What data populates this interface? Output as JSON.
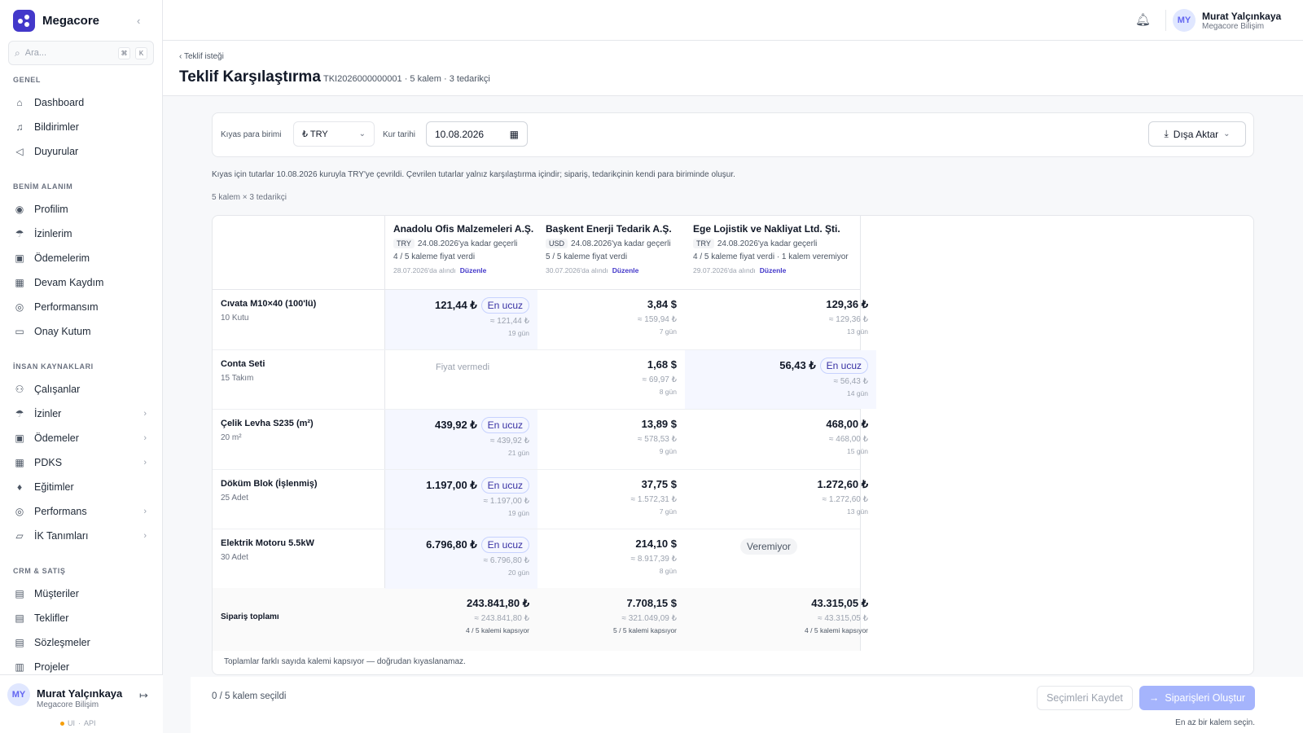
{
  "brand": {
    "name": "Megacore"
  },
  "search": {
    "placeholder": "Ara...",
    "key1": "⌘",
    "key2": "K"
  },
  "sidebar": {
    "sections": [
      {
        "title": "GENEL",
        "items": [
          {
            "label": "Dashboard",
            "icon": "home-icon"
          },
          {
            "label": "Bildirimler",
            "icon": "bell-icon"
          },
          {
            "label": "Duyurular",
            "icon": "megaphone-icon"
          }
        ]
      },
      {
        "title": "BENİM ALANIM",
        "items": [
          {
            "label": "Profilim",
            "icon": "user-circle-icon"
          },
          {
            "label": "İzinlerim",
            "icon": "umbrella-icon"
          },
          {
            "label": "Ödemelerim",
            "icon": "wallet-icon"
          },
          {
            "label": "Devam Kaydım",
            "icon": "calendar-check-icon"
          },
          {
            "label": "Performansım",
            "icon": "target-icon"
          },
          {
            "label": "Onay Kutum",
            "icon": "inbox-icon"
          }
        ]
      },
      {
        "title": "İNSAN KAYNAKLARI",
        "items": [
          {
            "label": "Çalışanlar",
            "icon": "users-icon"
          },
          {
            "label": "İzinler",
            "icon": "umbrella-icon",
            "expandable": true
          },
          {
            "label": "Ödemeler",
            "icon": "wallet-icon",
            "expandable": true
          },
          {
            "label": "PDKS",
            "icon": "calendar-check-icon",
            "expandable": true
          },
          {
            "label": "Eğitimler",
            "icon": "graduation-cap-icon"
          },
          {
            "label": "Performans",
            "icon": "target-icon",
            "expandable": true
          },
          {
            "label": "İK Tanımları",
            "icon": "folder-icon",
            "expandable": true
          }
        ]
      },
      {
        "title": "CRM & SATIŞ",
        "items": [
          {
            "label": "Müşteriler",
            "icon": "building-icon"
          },
          {
            "label": "Teklifler",
            "icon": "document-icon"
          },
          {
            "label": "Sözleşmeler",
            "icon": "contract-icon"
          },
          {
            "label": "Projeler",
            "icon": "briefcase-icon"
          }
        ]
      }
    ],
    "user": {
      "initials": "MY",
      "name": "Murat Yalçınkaya",
      "org": "Megacore Bilişim",
      "status_ui": "UI",
      "status_sep": "·",
      "status_api": "API"
    }
  },
  "header": {
    "user": {
      "initials": "MY",
      "name": "Murat Yalçınkaya",
      "org": "Megacore Bilişim"
    }
  },
  "page": {
    "breadcrumb": "Teklif isteği",
    "title": "Teklif Karşılaştırma",
    "subtitle": "TKI2026000000001 · 5 kalem · 3 tedarikçi"
  },
  "filters": {
    "currency_label": "Kıyas para birimi",
    "currency_value": "₺ TRY",
    "date_label": "Kur tarihi",
    "date_value": "10.08.2026",
    "export_label": "Dışa Aktar"
  },
  "notes": {
    "conversion": "Kıyas için tutarlar 10.08.2026 kuruyla TRY'ye çevrildi. Çevrilen tutarlar yalnız karşılaştırma içindir; sipariş, tedarikçinin kendi para biriminde oluşur.",
    "dimensions": "5 kalem × 3 tedarikçi",
    "footer": "Toplamlar farklı sayıda kalemi kapsıyor — doğrudan kıyaslanamaz."
  },
  "suppliers": [
    {
      "name": "Anadolu Ofis Malzemeleri A.Ş.",
      "currency": "TRY",
      "valid": "24.08.2026'ya kadar geçerli",
      "coverage": "4 / 5 kaleme fiyat verdi",
      "received": "28.07.2026'da alındı",
      "edit": "Düzenle"
    },
    {
      "name": "Başkent Enerji Tedarik A.Ş.",
      "currency": "USD",
      "valid": "24.08.2026'ya kadar geçerli",
      "coverage": "5 / 5 kaleme fiyat verdi",
      "received": "30.07.2026'da alındı",
      "edit": "Düzenle"
    },
    {
      "name": "Ege Lojistik ve Nakliyat Ltd. Şti.",
      "currency": "TRY",
      "valid": "24.08.2026'ya kadar geçerli",
      "coverage": "4 / 5 kaleme fiyat verdi · 1 kalem veremiyor",
      "received": "29.07.2026'da alındı",
      "edit": "Düzenle"
    }
  ],
  "cheapest_label": "En ucuz",
  "items": [
    {
      "name": "Cıvata M10×40 (100'lü)",
      "qty": "10 Kutu",
      "offers": [
        {
          "price": "121,44 ₺",
          "conv": "≈ 121,44 ₺",
          "days": "19 gün",
          "cheapest": true
        },
        {
          "price": "3,84 $",
          "conv": "≈ 159,94 ₺",
          "days": "7 gün"
        },
        {
          "price": "129,36 ₺",
          "conv": "≈ 129,36 ₺",
          "days": "13 gün"
        }
      ]
    },
    {
      "name": "Conta Seti",
      "qty": "15 Takım",
      "offers": [
        {
          "no_price": "Fiyat vermedi"
        },
        {
          "price": "1,68 $",
          "conv": "≈ 69,97 ₺",
          "days": "8 gün"
        },
        {
          "price": "56,43 ₺",
          "conv": "≈ 56,43 ₺",
          "days": "14 gün",
          "cheapest": true
        }
      ]
    },
    {
      "name": "Çelik Levha S235 (m²)",
      "qty": "20 m²",
      "offers": [
        {
          "price": "439,92 ₺",
          "conv": "≈ 439,92 ₺",
          "days": "21 gün",
          "cheapest": true
        },
        {
          "price": "13,89 $",
          "conv": "≈ 578,53 ₺",
          "days": "9 gün"
        },
        {
          "price": "468,00 ₺",
          "conv": "≈ 468,00 ₺",
          "days": "15 gün"
        }
      ]
    },
    {
      "name": "Döküm Blok (İşlenmiş)",
      "qty": "25 Adet",
      "offers": [
        {
          "price": "1.197,00 ₺",
          "conv": "≈ 1.197,00 ₺",
          "days": "19 gün",
          "cheapest": true
        },
        {
          "price": "37,75 $",
          "conv": "≈ 1.572,31 ₺",
          "days": "7 gün"
        },
        {
          "price": "1.272,60 ₺",
          "conv": "≈ 1.272,60 ₺",
          "days": "13 gün"
        }
      ]
    },
    {
      "name": "Elektrik Motoru 5.5kW",
      "qty": "30 Adet",
      "offers": [
        {
          "price": "6.796,80 ₺",
          "conv": "≈ 6.796,80 ₺",
          "days": "20 gün",
          "cheapest": true
        },
        {
          "price": "214,10 $",
          "conv": "≈ 8.917,39 ₺",
          "days": "8 gün"
        },
        {
          "unavailable": "Veremiyor"
        }
      ]
    }
  ],
  "totals": {
    "label": "Sipariş toplamı",
    "values": [
      {
        "price": "243.841,80 ₺",
        "conv": "≈ 243.841,80 ₺",
        "coverage": "4 / 5 kalemi kapsıyor"
      },
      {
        "price": "7.708,15 $",
        "conv": "≈ 321.049,09 ₺",
        "coverage": "5 / 5 kalemi kapsıyor"
      },
      {
        "price": "43.315,05 ₺",
        "conv": "≈ 43.315,05 ₺",
        "coverage": "4 / 5 kalemi kapsıyor"
      }
    ]
  },
  "bottom": {
    "selection": "0 / 5 kalem seçildi",
    "save_label": "Seçimleri Kaydet",
    "order_label": "Siparişleri Oluştur",
    "hint": "En az bir kalem seçin."
  },
  "colors": {
    "accent": "#4338ca",
    "accent_light": "#a5b4fc",
    "cheapest_bg": "#f5f7ff"
  }
}
